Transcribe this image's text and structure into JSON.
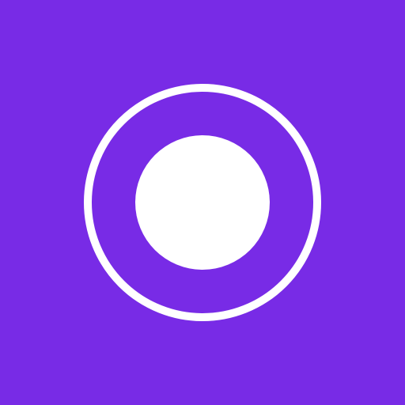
{
  "icon": {
    "name": "record-icon",
    "colors": {
      "background": "#782be6",
      "foreground": "#ffffff"
    }
  }
}
